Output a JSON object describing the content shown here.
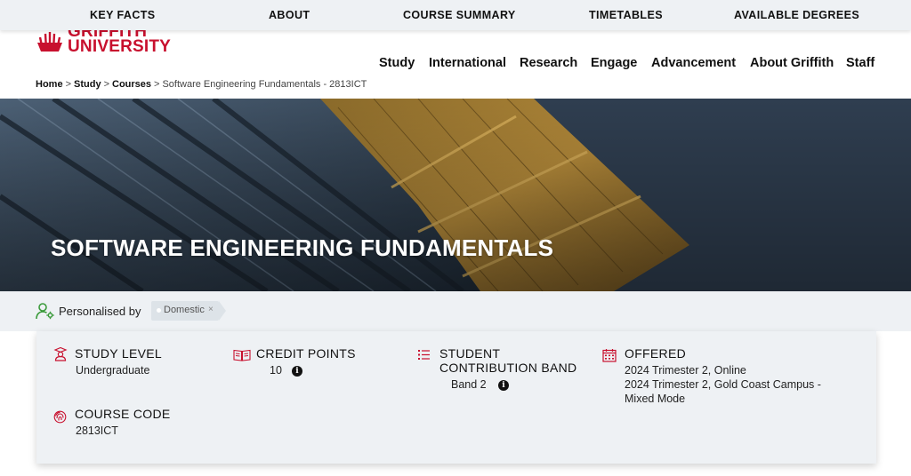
{
  "topnav": {
    "items": [
      "KEY FACTS",
      "ABOUT",
      "COURSE SUMMARY",
      "TIMETABLES",
      "AVAILABLE DEGREES"
    ]
  },
  "logo": {
    "line1": "GRIFFITH",
    "line2": "UNIVERSITY",
    "icon": "griffith-logo-icon"
  },
  "mainnav": {
    "items": [
      "Study",
      "International",
      "Research",
      "Engage",
      "Advancement",
      "About Griffith",
      "Staff"
    ]
  },
  "breadcrumb": {
    "items": [
      "Home",
      "Study",
      "Courses"
    ],
    "separator": ">",
    "current": "Software Engineering Fundamentals - 2813ICT"
  },
  "hero": {
    "title": "SOFTWARE ENGINEERING FUNDAMENTALS"
  },
  "personalised": {
    "label": "Personalised by",
    "chip": "Domestic",
    "chip_close": "×",
    "icon": "user-gear-icon"
  },
  "facts": {
    "study_level": {
      "heading": "STUDY LEVEL",
      "value": "Undergraduate",
      "icon": "graduate-icon"
    },
    "credit_points": {
      "heading": "CREDIT POINTS",
      "value": "10",
      "icon": "book-icon",
      "info": "i"
    },
    "contribution_band": {
      "heading_line1": "STUDENT",
      "heading_line2": "CONTRIBUTION BAND",
      "value": "Band 2",
      "icon": "list-icon",
      "info": "i"
    },
    "offered": {
      "heading": "OFFERED",
      "lines": [
        "2024 Trimester 2, Online",
        "2024 Trimester 2, Gold Coast Campus -",
        "Mixed Mode"
      ],
      "icon": "calendar-icon"
    },
    "course_code": {
      "heading": "COURSE CODE",
      "value": "2813ICT",
      "icon": "fingerprint-icon"
    }
  },
  "colors": {
    "brand_red": "#c8102e",
    "topbar_bg": "#eef1f4",
    "hero_bg": "#2f3e50",
    "accent_green": "#3a9a3a"
  }
}
